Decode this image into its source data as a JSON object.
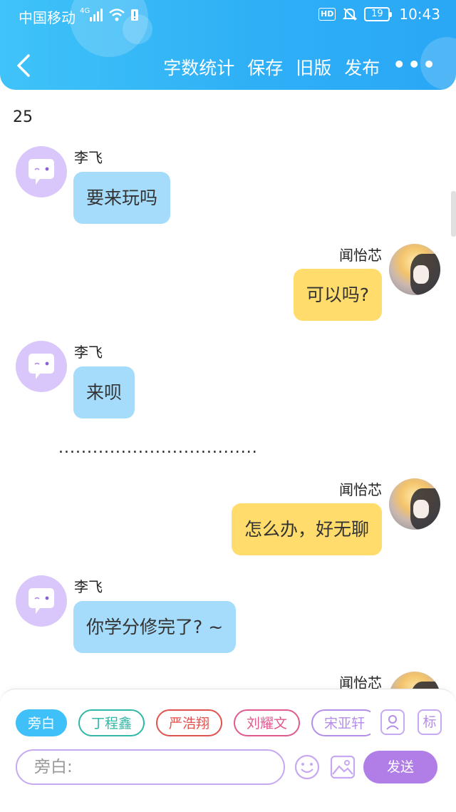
{
  "status_bar": {
    "carrier": "中国移动",
    "network": "4G",
    "hd": "HD",
    "battery": "19",
    "time": "10:43"
  },
  "nav": {
    "actions": [
      "字数统计",
      "保存",
      "旧版",
      "发布"
    ],
    "more": "•••"
  },
  "counter": "25",
  "messages": [
    {
      "side": "left",
      "name": "李飞",
      "text": "要来玩吗"
    },
    {
      "side": "right",
      "name": "闻怡芯",
      "text": "可以吗?"
    },
    {
      "side": "left",
      "name": "李飞",
      "text": "来呗"
    },
    {
      "side": "right",
      "name": "闻怡芯",
      "text": "怎么办，好无聊"
    },
    {
      "side": "left",
      "name": "李飞",
      "text": "你学分修完了? ~"
    },
    {
      "side": "right",
      "name": "闻怡芯",
      "text": ""
    }
  ],
  "separator": "...................................",
  "characters": [
    {
      "label": "旁白",
      "color": "#3fc0f8"
    },
    {
      "label": "丁程鑫",
      "color": "#2fb8a6"
    },
    {
      "label": "严浩翔",
      "color": "#e0524f"
    },
    {
      "label": "刘耀文",
      "color": "#e05a8f"
    },
    {
      "label": "宋亚轩",
      "color": "#b48ee9"
    }
  ],
  "tools": {
    "mark_label": "标"
  },
  "input": {
    "placeholder": "旁白:"
  },
  "send_label": "发送",
  "colors": {
    "header": "#2fb0f6",
    "bubble_left": "#a6dcfb",
    "bubble_right": "#ffdc6b",
    "accent": "#b17ee8"
  }
}
